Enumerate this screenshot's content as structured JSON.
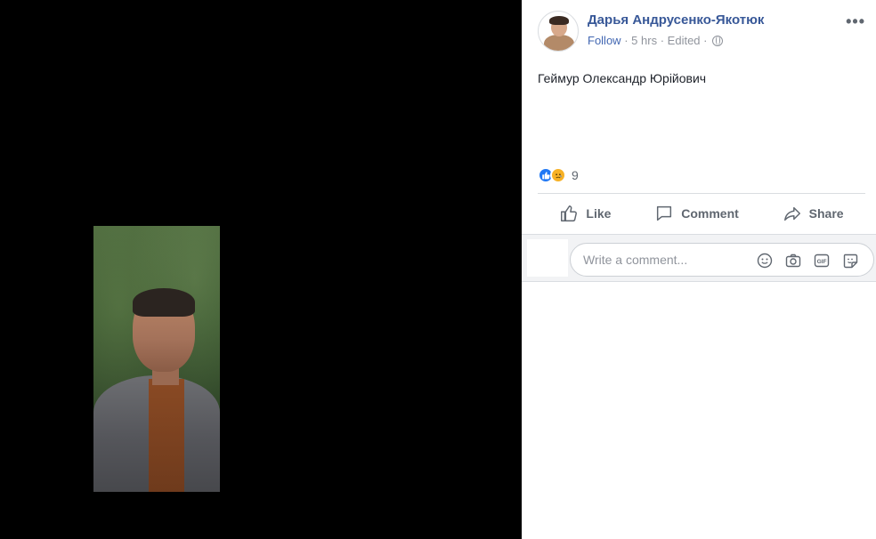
{
  "post": {
    "author": "Дарья Андрусенко-Якотюк",
    "follow_label": "Follow",
    "separator": "·",
    "time": "5 hrs",
    "edited": "Edited",
    "privacy_icon": "globe-icon",
    "more_icon": "more-options-icon",
    "more_label": "•••",
    "text": "Геймур Олександр Юрійович"
  },
  "reactions": {
    "types": [
      "like",
      "sad"
    ],
    "count": "9"
  },
  "actions": {
    "like_label": "Like",
    "comment_label": "Comment",
    "share_label": "Share"
  },
  "comment_box": {
    "placeholder": "Write a comment...",
    "icons": [
      "emoji-icon",
      "camera-icon",
      "gif-icon",
      "sticker-icon"
    ]
  },
  "colors": {
    "brand_link": "#385898",
    "follow": "#4267b2",
    "like_reaction": "#2078f4",
    "sad_reaction": "#f7b125",
    "muted_text": "#90949c",
    "photo_background": "#000000"
  }
}
